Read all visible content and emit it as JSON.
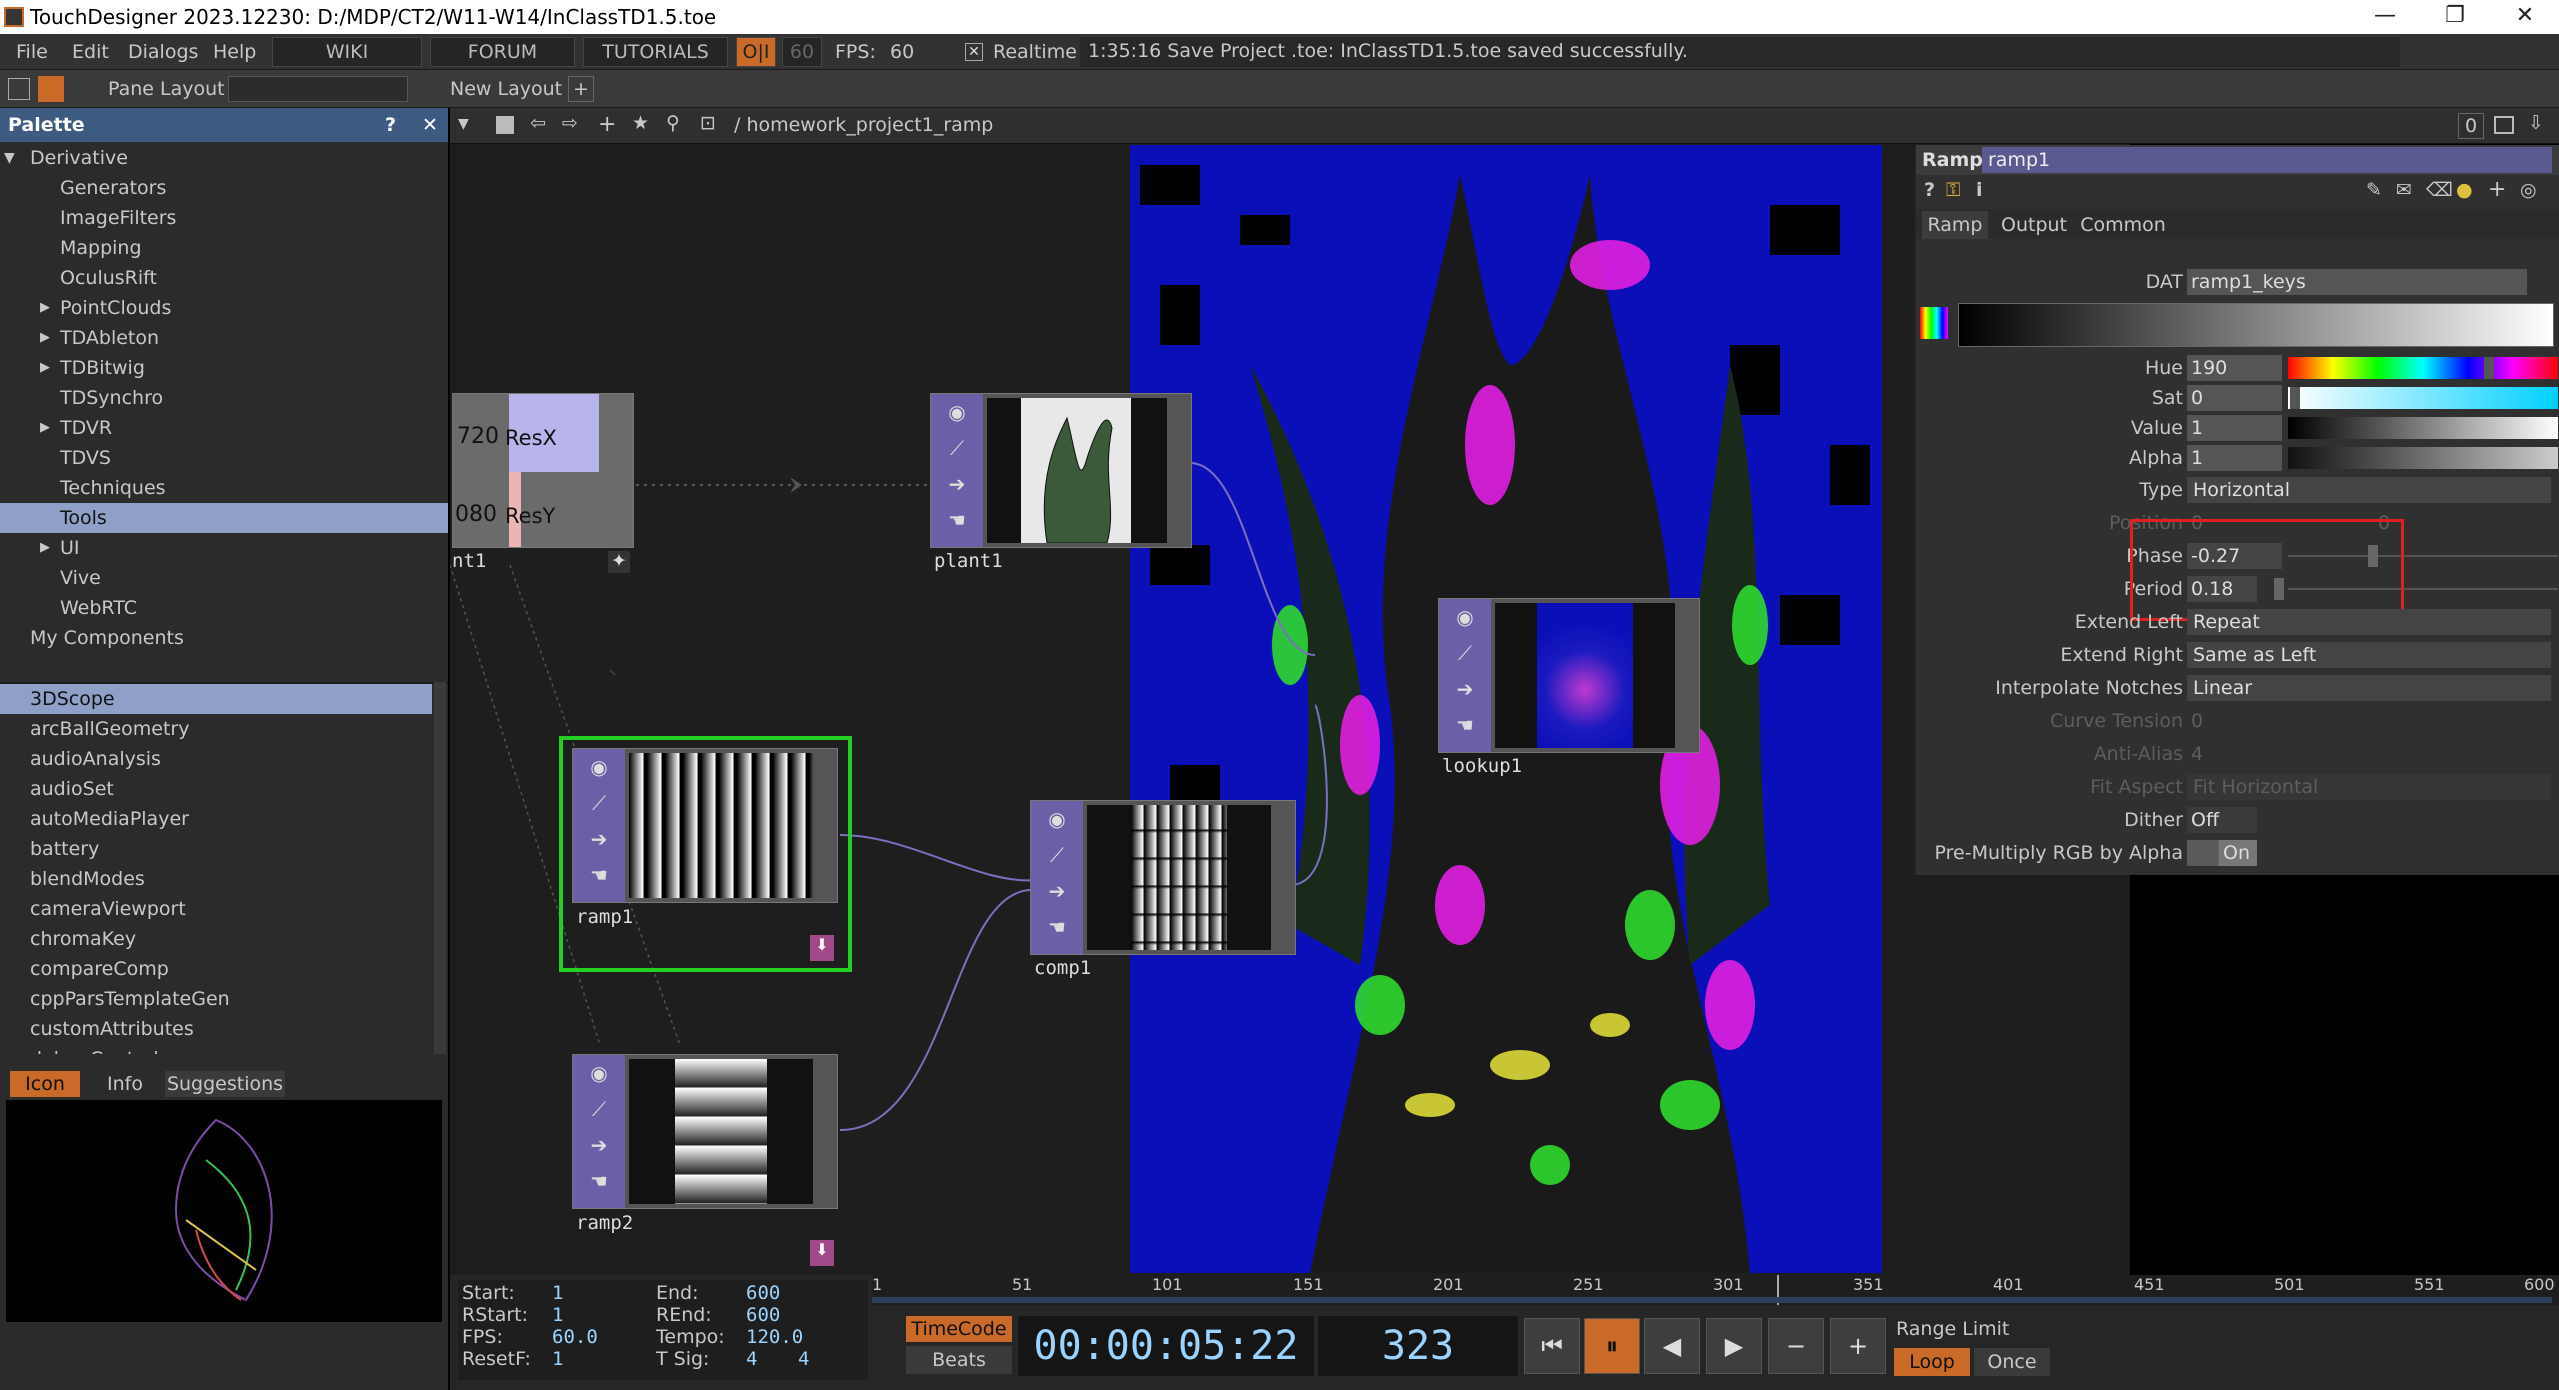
{
  "window": {
    "title": "TouchDesigner 2023.12230: D:/MDP/CT2/W11-W14/InClassTD1.5.toe",
    "min": "—",
    "max": "❐",
    "close": "✕"
  },
  "menu": {
    "items": [
      "File",
      "Edit",
      "Dialogs",
      "Help"
    ],
    "wiki": "WIKI",
    "forum": "FORUM",
    "tutorials": "TUTORIALS",
    "oi": "O|I",
    "fps_cap": "60",
    "fps_label": "FPS:",
    "fps_value": "60",
    "realtime": "Realtime",
    "status": "1:35:16 Save Project .toe: InClassTD1.5.toe saved successfully."
  },
  "toolbar": {
    "pane_layout": "Pane Layout",
    "new_layout": "New Layout",
    "plus": "+"
  },
  "palette": {
    "title": "Palette",
    "help": "?",
    "close": "✕",
    "tree": [
      {
        "label": "Derivative",
        "expand": "▼"
      },
      {
        "label": "Generators"
      },
      {
        "label": "ImageFilters"
      },
      {
        "label": "Mapping"
      },
      {
        "label": "OculusRift"
      },
      {
        "label": "PointClouds",
        "expand": "▶"
      },
      {
        "label": "TDAbleton",
        "expand": "▶"
      },
      {
        "label": "TDBitwig",
        "expand": "▶"
      },
      {
        "label": "TDSynchro"
      },
      {
        "label": "TDVR",
        "expand": "▶"
      },
      {
        "label": "TDVS"
      },
      {
        "label": "Techniques"
      },
      {
        "label": "Tools"
      },
      {
        "label": "UI",
        "expand": "▶"
      },
      {
        "label": "Vive"
      },
      {
        "label": "WebRTC"
      },
      {
        "label": "My Components"
      }
    ],
    "components": [
      "3DScope",
      "arcBallGeometry",
      "audioAnalysis",
      "audioSet",
      "autoMediaPlayer",
      "battery",
      "blendModes",
      "cameraViewport",
      "chromaKey",
      "compareComp",
      "cppParsTemplateGen",
      "customAttributes",
      "debugControl"
    ],
    "tabs": {
      "icon": "Icon",
      "info": "Info",
      "suggestions": "Suggestions"
    }
  },
  "network": {
    "path": "/ homework_project1_ramp",
    "right_num": "0",
    "nodes": {
      "crop_a": "720",
      "crop_resx": "ResX",
      "crop_b": "080",
      "crop_resy": "ResY",
      "crop_name": "nt1",
      "plant1": "plant1",
      "ramp1": "ramp1",
      "ramp2": "ramp2",
      "comp1": "comp1",
      "lookup1": "lookup1"
    }
  },
  "params": {
    "op_type": "Ramp",
    "op_name": "ramp1",
    "tabs": [
      "Ramp",
      "Output",
      "Common"
    ],
    "dat_label": "DAT",
    "dat_value": "ramp1_keys",
    "hue_label": "Hue",
    "hue": "190",
    "sat_label": "Sat",
    "sat": "0",
    "value_label": "Value",
    "value": "1",
    "alpha_label": "Alpha",
    "alpha": "1",
    "type_label": "Type",
    "type": "Horizontal",
    "position_label": "Position",
    "position_a": "0",
    "position_b": "0",
    "phase_label": "Phase",
    "phase": "-0.27",
    "period_label": "Period",
    "period": "0.18",
    "extl_label": "Extend Left",
    "extl": "Repeat",
    "extr_label": "Extend Right",
    "extr": "Same as Left",
    "interp_label": "Interpolate Notches",
    "interp": "Linear",
    "tension_label": "Curve Tension",
    "tension": "0",
    "aa_label": "Anti-Alias",
    "aa": "4",
    "fitaspect_label": "Fit Aspect",
    "fitaspect": "Fit Horizontal",
    "dither_label": "Dither",
    "dither": "Off",
    "premult_label": "Pre-Multiply RGB by Alpha",
    "premult": "On"
  },
  "timeline": {
    "start_label": "Start:",
    "start": "1",
    "end_label": "End:",
    "end": "600",
    "rstart_label": "RStart:",
    "rstart": "1",
    "rend_label": "REnd:",
    "rend": "600",
    "fps_label": "FPS:",
    "fps": "60.0",
    "tempo_label": "Tempo:",
    "tempo": "120.0",
    "resetf_label": "ResetF:",
    "resetf": "1",
    "tsig_label": "T Sig:",
    "tsig_a": "4",
    "tsig_b": "4",
    "timecode": "TimeCode",
    "beats": "Beats",
    "time": "00:00:05:22",
    "frame": "323",
    "range_limit": "Range Limit",
    "loop": "Loop",
    "once": "Once",
    "ticks": [
      "1",
      "51",
      "101",
      "151",
      "201",
      "251",
      "301",
      "351",
      "401",
      "451",
      "501",
      "551",
      "600"
    ]
  }
}
